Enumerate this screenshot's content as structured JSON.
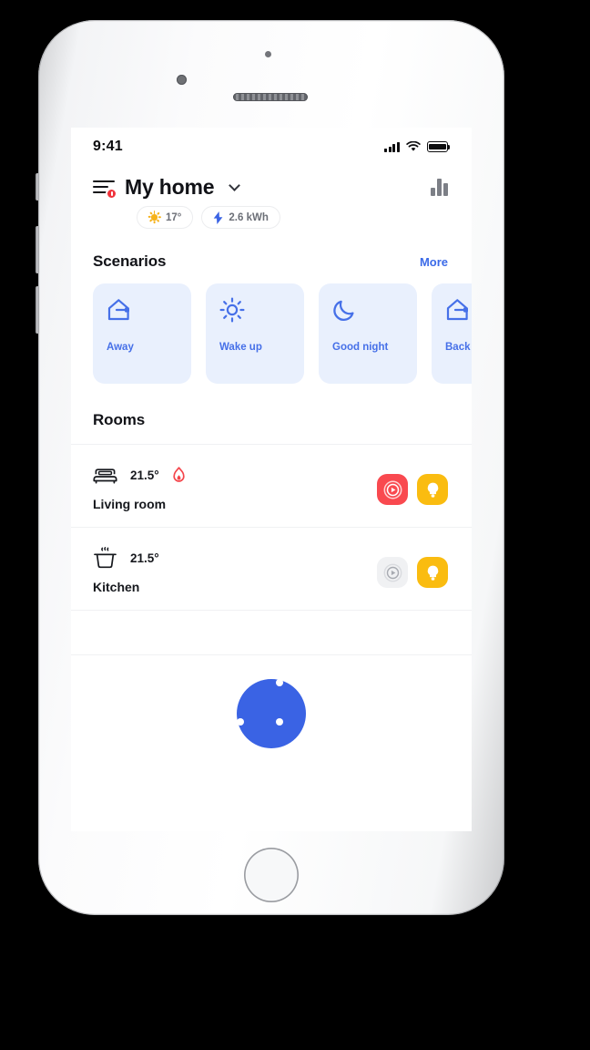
{
  "status_bar": {
    "time": "9:41",
    "signal_icon": "cellular-signal-icon",
    "wifi_icon": "wifi-icon",
    "battery_icon": "battery-full-icon"
  },
  "header": {
    "menu_icon": "hamburger-menu-icon",
    "menu_badge_icon": "alert-badge-icon",
    "title": "My home",
    "dropdown_icon": "chevron-down-icon",
    "stats_icon": "bar-chart-icon",
    "chips": [
      {
        "icon": "sun-icon",
        "label": "17°"
      },
      {
        "icon": "lightning-bolt-icon",
        "label": "2.6 kWh"
      }
    ]
  },
  "scenarios": {
    "title": "Scenarios",
    "more_label": "More",
    "cards": [
      {
        "label": "Away",
        "icon": "house-leaving-icon"
      },
      {
        "label": "Wake up",
        "icon": "sun-icon"
      },
      {
        "label": "Good night",
        "icon": "moon-icon"
      },
      {
        "label": "Back",
        "icon": "house-arriving-icon"
      }
    ]
  },
  "rooms": {
    "title": "Rooms",
    "items": [
      {
        "name": "Living room",
        "icon": "sofa-icon",
        "temperature": "21.5°",
        "heating_icon": "flame-icon",
        "heating_active": true,
        "actions": [
          {
            "icon": "media-play-icon",
            "state": "on",
            "color": "#f9494f"
          },
          {
            "icon": "light-bulb-icon",
            "state": "on",
            "color": "#fabc10"
          }
        ]
      },
      {
        "name": "Kitchen",
        "icon": "cooking-pot-icon",
        "temperature": "21.5°",
        "heating_icon": "",
        "heating_active": false,
        "actions": [
          {
            "icon": "media-play-icon",
            "state": "off",
            "color": "#f0f1f3"
          },
          {
            "icon": "light-bulb-icon",
            "state": "on",
            "color": "#fabc10"
          }
        ]
      }
    ]
  },
  "fab": {
    "icon": "grid-dots-icon",
    "color": "#3a63e4"
  },
  "device": {
    "camera_icon": "front-camera-icon",
    "speaker_icon": "earpiece-speaker-icon",
    "sensor_icon": "proximity-sensor-icon",
    "home_button_icon": "home-button-icon"
  },
  "colors": {
    "accent_blue": "#3a63e4",
    "scenario_blue": "#4670e8",
    "scenario_card_bg": "#e9f0fd",
    "media_red": "#f9494f",
    "bulb_yellow": "#fabc10",
    "badge_red": "#f0333b"
  }
}
